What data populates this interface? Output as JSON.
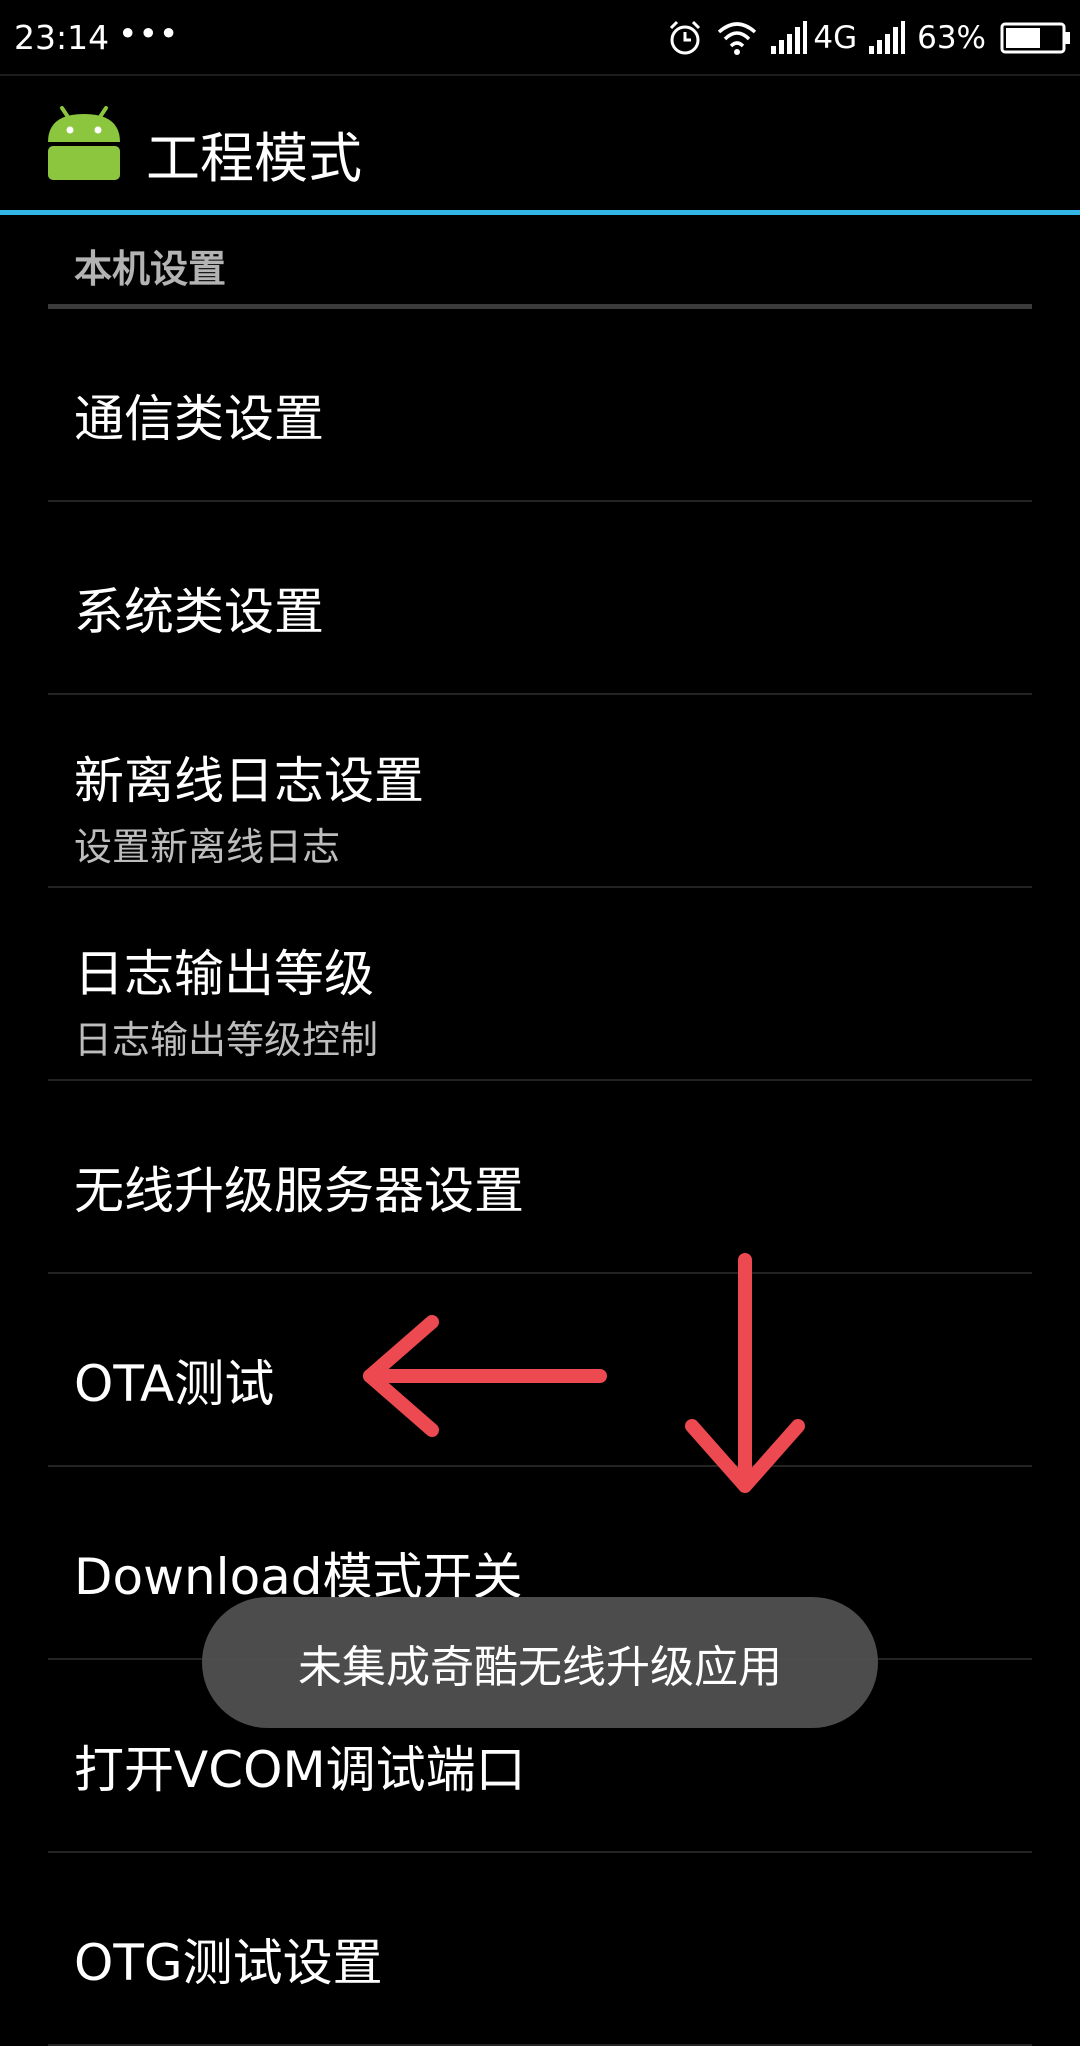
{
  "status_bar": {
    "time": "23:14",
    "more": "•••",
    "network": "4G",
    "battery": "63%",
    "battery_level": 0.63,
    "icons": [
      "alarm-icon",
      "wifi-icon",
      "signal-icon",
      "signal-icon",
      "battery-icon"
    ]
  },
  "action_bar": {
    "title": "工程模式",
    "icon": "android-app-icon",
    "accent_color": "#33b5e5"
  },
  "category": {
    "title": "本机设置"
  },
  "items": [
    {
      "title": "通信类设置"
    },
    {
      "title": "系统类设置"
    },
    {
      "title": "新离线日志设置",
      "summary": "设置新离线日志"
    },
    {
      "title": "日志输出等级",
      "summary": "日志输出等级控制"
    },
    {
      "title": "无线升级服务器设置"
    },
    {
      "title": "OTA测试"
    },
    {
      "title": "Download模式开关"
    },
    {
      "title": "打开VCOM调试端口"
    },
    {
      "title": "OTG测试设置"
    }
  ],
  "toast": {
    "message": "未集成奇酷无线升级应用"
  },
  "annotations": {
    "arrow_color": "#ec4a50",
    "arrows": [
      "left-arrow",
      "down-arrow"
    ]
  }
}
